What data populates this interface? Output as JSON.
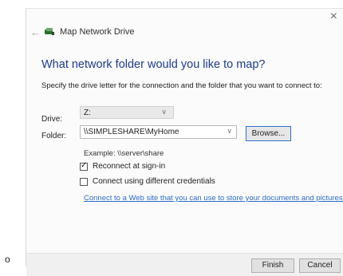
{
  "top_snippet": "",
  "dialog": {
    "close_glyph": "×",
    "back_glyph": "←",
    "window_title": "Map Network Drive",
    "heading": "What network folder would you like to map?",
    "description": "Specify the drive letter for the connection and the folder that you want to connect to:",
    "drive_label": "Drive:",
    "drive_value": "Z:",
    "folder_label": "Folder:",
    "folder_value": "\\\\SIMPLESHARE\\MyHome",
    "browse_label": "Browse...",
    "example_text": "Example: \\\\server\\share",
    "reconnect_label": "Reconnect at sign-in",
    "reconnect_checked": true,
    "diff_credentials_label": "Connect using different credentials",
    "diff_credentials_checked": false,
    "link_text": "Connect to a Web site that you can use to store your documents and pictures.",
    "finish_label": "Finish",
    "cancel_label": "Cancel"
  },
  "outside": {
    "bullet_char": "o"
  },
  "icons": {
    "window_icon": "network-drive-icon",
    "close_icon": "close-icon",
    "back_icon": "back-arrow-icon",
    "chevron": "chevron-down-icon"
  }
}
